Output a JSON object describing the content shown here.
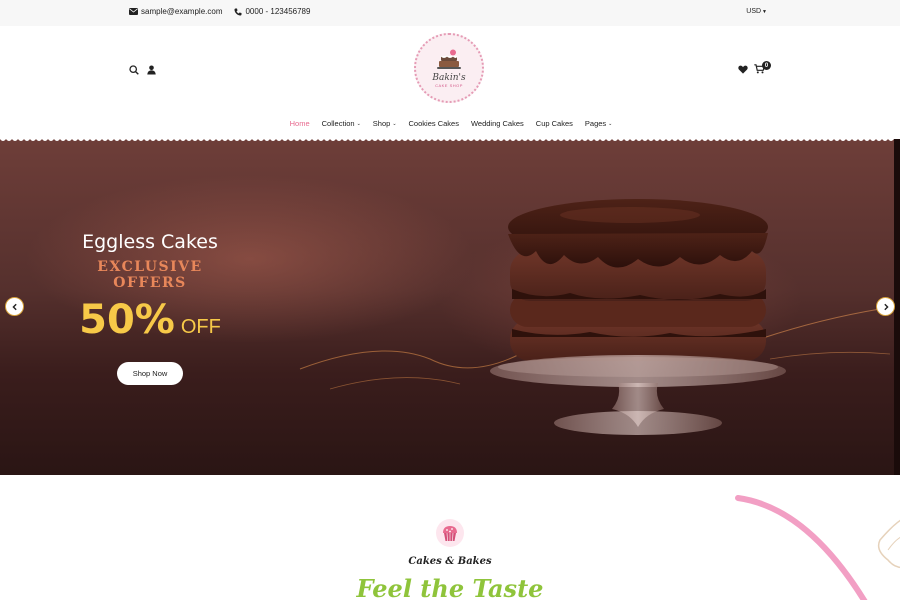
{
  "topbar": {
    "email": "sample@example.com",
    "phone": "0000 - 123456789",
    "currency": "USD"
  },
  "header": {
    "logo_name": "Bakin's",
    "logo_sub": "CAKE SHOP",
    "cart_count": "0"
  },
  "nav": {
    "items": [
      {
        "label": "Home",
        "active": true
      },
      {
        "label": "Collection",
        "dropdown": true
      },
      {
        "label": "Shop",
        "dropdown": true
      },
      {
        "label": "Cookies Cakes"
      },
      {
        "label": "Wedding Cakes"
      },
      {
        "label": "Cup Cakes"
      },
      {
        "label": "Pages",
        "dropdown": true
      }
    ]
  },
  "hero": {
    "title": "Eggless Cakes",
    "offer": "EXCLUSIVE OFFERS",
    "percent": "50%",
    "off": "OFF",
    "button": "Shop Now"
  },
  "section": {
    "subtitle": "Cakes & Bakes",
    "title": "Feel the Taste"
  },
  "colors": {
    "accent_pink": "#e86a8f",
    "offer_orange": "#e8875a",
    "percent_yellow": "#f7c948",
    "title_green": "#8fc43b"
  },
  "icons": [
    "envelope-icon",
    "phone-icon",
    "search-icon",
    "user-icon",
    "heart-icon",
    "cart-icon",
    "chevron-left-icon",
    "chevron-right-icon",
    "cupcake-icon"
  ]
}
